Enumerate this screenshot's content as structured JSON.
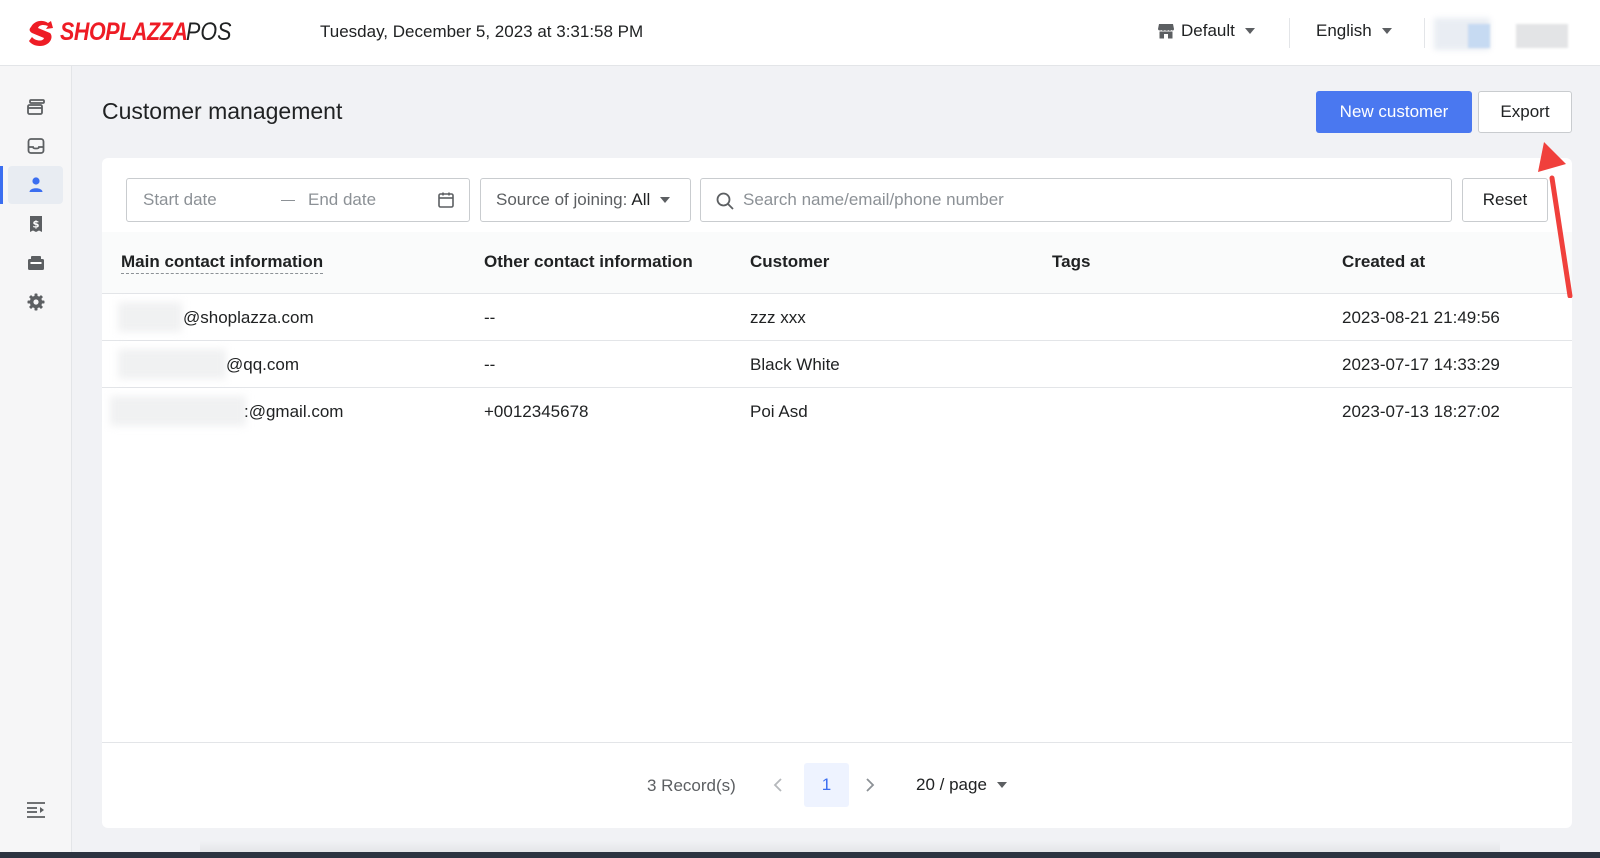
{
  "header": {
    "brand": "SHOPLAZZA",
    "brand_suffix": "POS",
    "datetime": "Tuesday, December 5, 2023 at 3:31:58 PM",
    "store_label": "Default",
    "language_label": "English"
  },
  "sidebar": {
    "items": [
      {
        "icon": "orders-icon"
      },
      {
        "icon": "inbox-icon"
      },
      {
        "icon": "customer-icon",
        "active": true
      },
      {
        "icon": "receipt-icon"
      },
      {
        "icon": "register-icon"
      },
      {
        "icon": "gear-icon"
      }
    ]
  },
  "page": {
    "title": "Customer management",
    "new_button": "New customer",
    "export_button": "Export"
  },
  "filters": {
    "start_placeholder": "Start date",
    "end_placeholder": "End date",
    "source_label": "Source of joining:",
    "source_value": "All",
    "search_placeholder": "Search name/email/phone number",
    "reset_button": "Reset"
  },
  "table": {
    "columns": [
      "Main contact information",
      "Other contact information",
      "Customer",
      "Tags",
      "Created at"
    ],
    "rows": [
      {
        "main": "@shoplazza.com",
        "other": "--",
        "customer": "zzz xxx",
        "tags": "",
        "created": "2023-08-21 21:49:56"
      },
      {
        "main": "@qq.com",
        "other": "--",
        "customer": "Black White",
        "tags": "",
        "created": "2023-07-17 14:33:29"
      },
      {
        "main": ":@gmail.com",
        "other": "+0012345678",
        "customer": "Poi Asd",
        "tags": "",
        "created": "2023-07-13 18:27:02"
      }
    ]
  },
  "pagination": {
    "records": "3 Record(s)",
    "current_page": "1",
    "page_size": "20 / page"
  },
  "colors": {
    "primary": "#4a78f0",
    "brand_red": "#ee1c25",
    "annotation_arrow": "#f0403c"
  }
}
